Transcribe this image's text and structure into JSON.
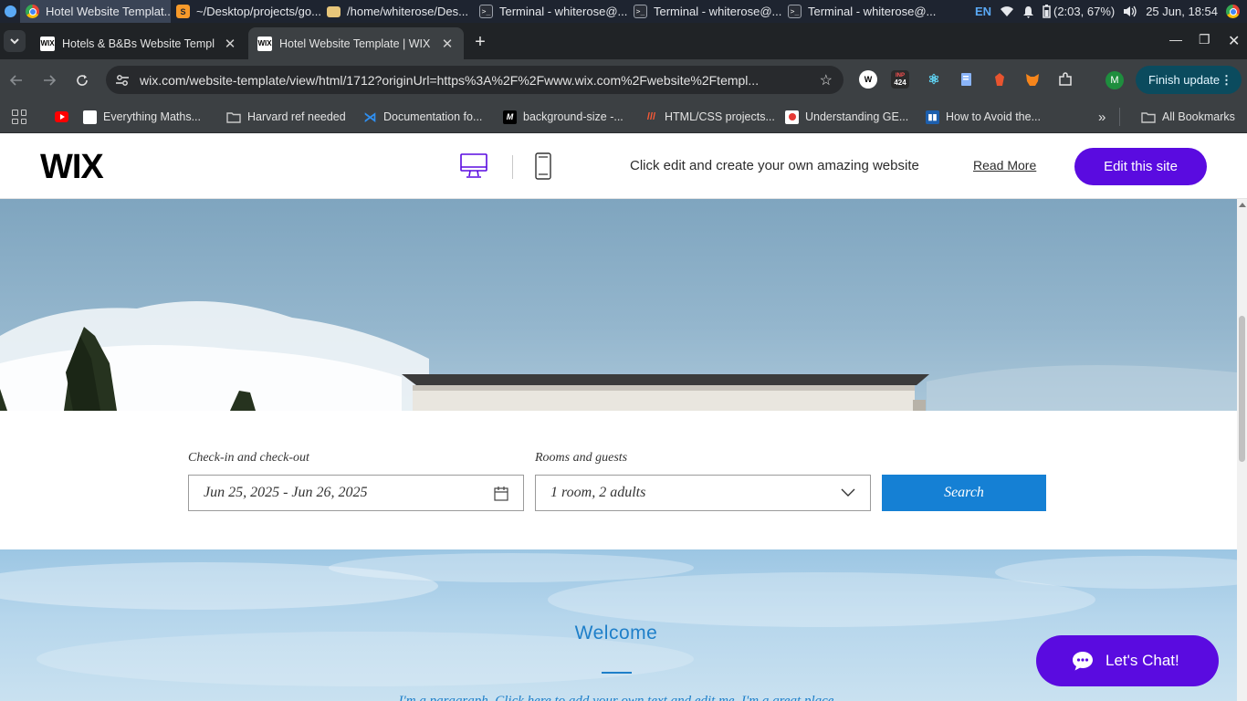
{
  "taskbar": {
    "tasks": [
      {
        "label": "Hotel Website Templat...",
        "icon": "chrome-icon",
        "active": true
      },
      {
        "label": "~/Desktop/projects/go...",
        "icon": "sublime-icon"
      },
      {
        "label": "/home/whiterose/Des...",
        "icon": "folder-icon"
      },
      {
        "label": "Terminal - whiterose@...",
        "icon": "terminal-icon"
      },
      {
        "label": "Terminal - whiterose@...",
        "icon": "terminal-icon"
      },
      {
        "label": "Terminal - whiterose@...",
        "icon": "terminal-icon"
      }
    ],
    "language": "EN",
    "battery": "(2:03, 67%)",
    "datetime": "25 Jun, 18:54"
  },
  "browser": {
    "tabs": [
      {
        "title": "Hotels & B&Bs Website Templ",
        "active": false
      },
      {
        "title": "Hotel Website Template | WIX",
        "active": true
      }
    ],
    "url": "wix.com/website-template/view/html/1712?originUrl=https%3A%2F%2Fwww.wix.com%2Fwebsite%2Ftempl...",
    "extensions": [
      "extension-w-icon",
      "extension-inp-icon",
      "react-devtools-icon",
      "docs-icon",
      "extension-red-icon",
      "metamask-icon",
      "puzzle-icon"
    ],
    "inp_badge": "424",
    "profile_initial": "M",
    "finish_update_label": "Finish update",
    "bookmarks": [
      {
        "label": "",
        "icon": "youtube-icon"
      },
      {
        "label": "Everything Maths...",
        "icon": "page-icon"
      },
      {
        "label": "Harvard ref needed",
        "icon": "folder-icon"
      },
      {
        "label": "Documentation fo...",
        "icon": "vscode-icon"
      },
      {
        "label": "background-size -...",
        "icon": "mdn-icon"
      },
      {
        "label": "HTML/CSS projects...",
        "icon": "project-icon"
      },
      {
        "label": "Understanding GE...",
        "icon": "red-circle-icon"
      },
      {
        "label": "How to Avoid the...",
        "icon": "trello-icon"
      }
    ],
    "all_bookmarks_label": "All Bookmarks"
  },
  "wix_header": {
    "logo": "WIX",
    "promo_text": "Click edit and create your own amazing website",
    "read_more": "Read More",
    "edit_button": "Edit this site",
    "brand_color": "#5a0be0"
  },
  "booking": {
    "checkin_label": "Check-in and check-out",
    "checkin_value": "Jun 25, 2025 - Jun 26, 2025",
    "guests_label": "Rooms and guests",
    "guests_value": "1 room, 2 adults",
    "search_button": "Search",
    "accent_color": "#1580d4"
  },
  "welcome": {
    "title": "Welcome",
    "body": "I'm a paragraph. Click here to add your own text and edit me. I'm a great place"
  },
  "chat": {
    "label": "Let's Chat!"
  }
}
